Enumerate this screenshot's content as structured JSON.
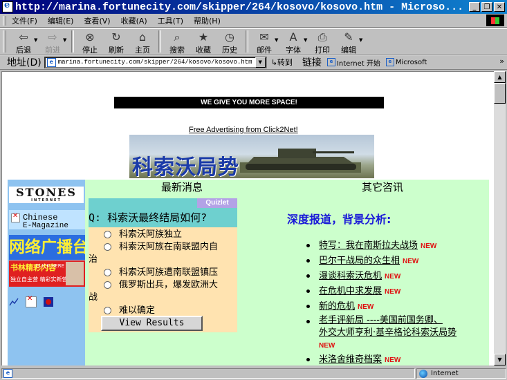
{
  "window": {
    "title": "http://marina.fortunecity.com/skipper/264/kosovo/kosovo.htm - Microso...",
    "buttons": [
      "_",
      "❐",
      "✕"
    ]
  },
  "menu": [
    "文件(F)",
    "编辑(E)",
    "查看(V)",
    "收藏(A)",
    "工具(T)",
    "帮助(H)"
  ],
  "toolbar": [
    {
      "label": "后退",
      "icon": "back-arrow-icon",
      "glyph": "⇦",
      "disabled": false,
      "dropdown": true
    },
    {
      "label": "前进",
      "icon": "forward-arrow-icon",
      "glyph": "⇨",
      "disabled": true,
      "dropdown": true
    },
    {
      "label": "停止",
      "icon": "stop-icon",
      "glyph": "⊗",
      "disabled": false,
      "dropdown": false
    },
    {
      "label": "刷新",
      "icon": "refresh-icon",
      "glyph": "↻",
      "disabled": false,
      "dropdown": false
    },
    {
      "label": "主页",
      "icon": "home-icon",
      "glyph": "⌂",
      "disabled": false,
      "dropdown": false
    },
    {
      "label": "搜索",
      "icon": "search-icon",
      "glyph": "⌕",
      "disabled": false,
      "dropdown": false
    },
    {
      "label": "收藏",
      "icon": "favorites-icon",
      "glyph": "★",
      "disabled": false,
      "dropdown": false
    },
    {
      "label": "历史",
      "icon": "history-icon",
      "glyph": "◷",
      "disabled": false,
      "dropdown": false
    },
    {
      "label": "邮件",
      "icon": "mail-icon",
      "glyph": "✉",
      "disabled": false,
      "dropdown": true
    },
    {
      "label": "字体",
      "icon": "font-icon",
      "glyph": "A",
      "disabled": false,
      "dropdown": true
    },
    {
      "label": "打印",
      "icon": "print-icon",
      "glyph": "⎙",
      "disabled": false,
      "dropdown": false
    },
    {
      "label": "编辑",
      "icon": "edit-icon",
      "glyph": "✎",
      "disabled": false,
      "dropdown": true
    }
  ],
  "address": {
    "label": "地址(D)",
    "url": "marina.fortunecity.com/skipper/264/kosovo/kosovo.htm",
    "go": "↳转到",
    "links_label": "链接",
    "links": [
      "Internet 开始",
      "Microsoft"
    ]
  },
  "page": {
    "top_banner": "WE GIVE YOU MORE SPACE!",
    "free_ad": "Free Advertising from Click2Net!",
    "kosovo_title": "科索沃局势",
    "sidebar": {
      "stones": "STONES",
      "stones_sub": "INTERNET",
      "mag_line1": "Chinese",
      "mag_line2": "E-Magazine",
      "radio": "网络广播台",
      "ad_line1": "书林精彩内容",
      "ad_line2": "独立自主营 精彩实新营销每台",
      "ad_click": "CLICK HERE"
    },
    "latest_heading": "最新消息",
    "other_heading": "其它咨讯",
    "poll": {
      "badge": "Quizlet",
      "question": "Q: 科索沃最终结局如何?",
      "options": [
        {
          "line1": "科索沃阿族独立",
          "line2": ""
        },
        {
          "line1": "科索沃阿族在南联盟内自",
          "line2": "治"
        },
        {
          "line1": "科索沃阿族遭南联盟镇压",
          "line2": ""
        },
        {
          "line1": "俄罗斯出兵，爆发欧洲大",
          "line2": "战"
        },
        {
          "line1": "难以确定",
          "line2": ""
        }
      ],
      "button": "View Results"
    },
    "deep_heading": "深度报道，背景分析:",
    "new_badge": "NEW",
    "news": [
      {
        "text": "特写：我在南斯拉夫战场",
        "new": true
      },
      {
        "text": "巴尔干战局的众生相",
        "new": true
      },
      {
        "text": "漫谈科索沃危机",
        "new": true
      },
      {
        "text": "在危机中求发展",
        "new": true
      },
      {
        "text": "新的危机",
        "new": true
      },
      {
        "text": "老手评新局 ----美国前国务卿、",
        "line2": "外交大师亨利·基辛格论科索沃局势",
        "new": true
      },
      {
        "text": "米洛舍维奇档案",
        "new": true
      }
    ]
  },
  "status": {
    "zone": "Internet"
  }
}
